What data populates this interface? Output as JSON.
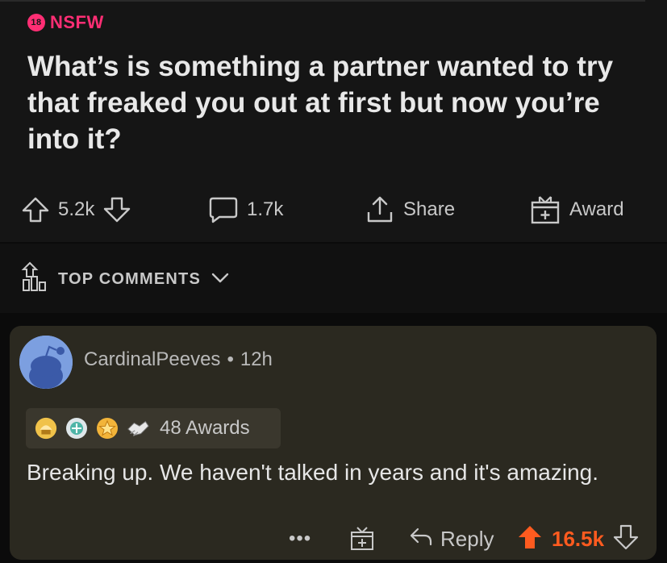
{
  "post": {
    "nsfw_badge": "18",
    "nsfw_label": "NSFW",
    "title": "What’s is something a partner wanted to try that freaked you out at first but now you’re into it?",
    "votes": "5.2k",
    "comments": "1.7k",
    "share_label": "Share",
    "award_label": "Award"
  },
  "sort": {
    "label": "TOP COMMENTS"
  },
  "comment": {
    "username": "CardinalPeeves",
    "separator": "•",
    "age": "12h",
    "awards_count": "48 Awards",
    "body": "Breaking up. We haven't talked in years and it's amazing.",
    "more": "•••",
    "reply_label": "Reply",
    "score": "16.5k"
  },
  "colors": {
    "nsfw": "#ff2e74",
    "upvoted": "#ff5b1f",
    "comment_bg": "#2b2920"
  }
}
